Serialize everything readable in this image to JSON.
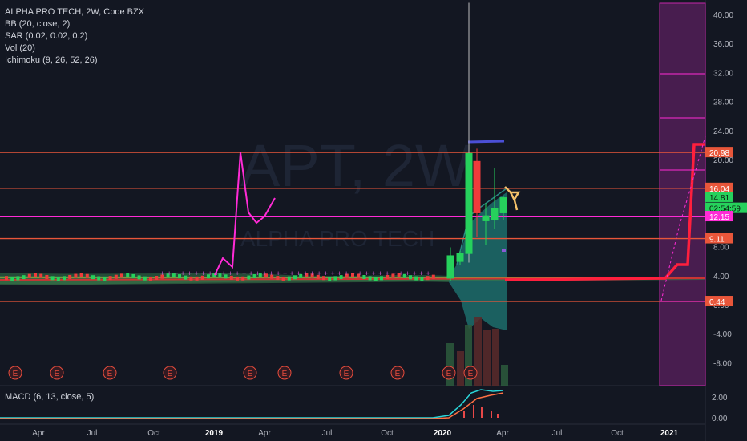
{
  "legend": {
    "title": "ALPHA PRO TECH, 2W, Cboe BZX",
    "bb": "BB (20, close, 2)",
    "sar": "SAR (0.02, 0.02, 0.2)",
    "vol": "Vol (20)",
    "ichimoku": "Ichimoku (9, 26, 52, 26)"
  },
  "macd_legend": "MACD (6, 13, close, 5)",
  "watermark": {
    "symbol": "APT, 2W",
    "name": "ALPHA PRO TECH"
  },
  "colors": {
    "bg": "#131722",
    "up": "#26d15c",
    "down": "#ef3b3b",
    "hline": "#e8563a",
    "magenta": "#ff2bd6",
    "purple_zone": "#5a1f5f",
    "bb_fill": "#1f7a76",
    "red_path": "#ff1f3d"
  },
  "chart_data": {
    "type": "candlestick",
    "y_axis": {
      "min": -12,
      "max": 42,
      "ticks": [
        "40.00",
        "36.00",
        "32.00",
        "28.00",
        "24.00",
        "20.00",
        "16.00",
        "12.00",
        "8.00",
        "4.00",
        "0.00",
        "-4.00",
        "-8.00"
      ]
    },
    "x_axis": {
      "ticks": [
        "Apr",
        "Jul",
        "Oct",
        "2019",
        "Apr",
        "Jul",
        "Oct",
        "2020",
        "Apr",
        "Jul",
        "Oct",
        "2021"
      ]
    },
    "horizontal_lines": [
      20.98,
      16.04,
      12.15,
      9.11,
      0.44
    ],
    "price_labels": [
      {
        "text": "20.98",
        "value": 20.98,
        "color": "#e8563a"
      },
      {
        "text": "16.04",
        "value": 16.04,
        "color": "#e8563a"
      },
      {
        "text": "14.81",
        "value": 14.81,
        "color": "#26d15c"
      },
      {
        "text": "02:54:59",
        "value": 13.3,
        "color": "#26d15c"
      },
      {
        "text": "12.15",
        "value": 12.15,
        "color": "#ff2bd6"
      },
      {
        "text": "9.11",
        "value": 9.11,
        "color": "#e8563a"
      },
      {
        "text": "0.44",
        "value": 0.44,
        "color": "#e8563a"
      }
    ],
    "candles": [
      {
        "x": "2020-01-17",
        "o": 3.6,
        "h": 7.9,
        "l": 3.3,
        "c": 6.8
      },
      {
        "x": "2020-01-31",
        "o": 5.9,
        "h": 7.4,
        "l": 5.5,
        "c": 7.1
      },
      {
        "x": "2020-02-07",
        "o": 7.0,
        "h": 41.6,
        "l": 5.8,
        "c": 20.9
      },
      {
        "x": "2020-02-21",
        "o": 19.8,
        "h": 21.5,
        "l": 9.3,
        "c": 12.6
      },
      {
        "x": "2020-03-06",
        "o": 11.5,
        "h": 14.0,
        "l": 8.2,
        "c": 12.3
      },
      {
        "x": "2020-03-20",
        "o": 11.6,
        "h": 18.8,
        "l": 10.5,
        "c": 13.3
      },
      {
        "x": "2020-04-03",
        "o": 12.6,
        "h": 14.9,
        "l": 11.7,
        "c": 14.8
      }
    ],
    "earnings_markers": [
      "E",
      "E",
      "E",
      "E",
      "E",
      "E",
      "E",
      "E",
      "E",
      "E"
    ],
    "macd_axis": {
      "ticks": [
        "2.00",
        "0.00"
      ]
    }
  }
}
